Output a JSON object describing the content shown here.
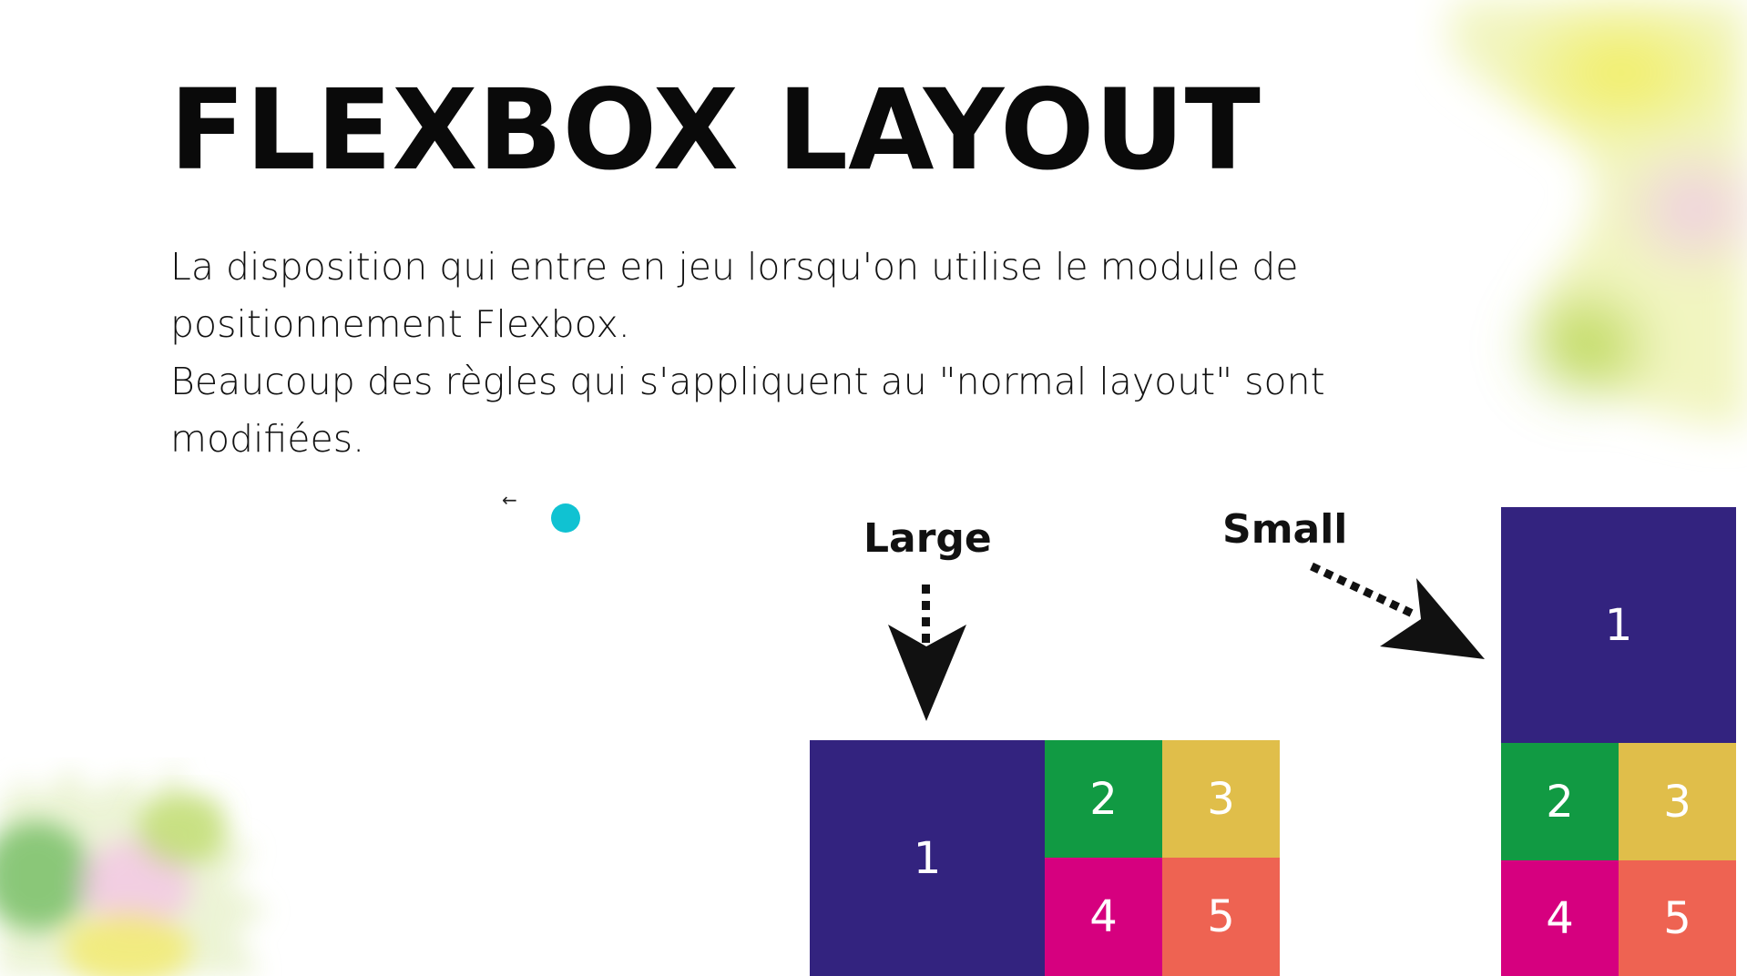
{
  "slide": {
    "title": "FLEXBOX LAYOUT",
    "paragraphs": [
      "La disposition qui entre en jeu lorsqu'on utilise le module de positionnement Flexbox.",
      "Beaucoup des règles qui s'appliquent au \"normal layout\" sont modifiées."
    ],
    "back_glyph": "←"
  },
  "diagram": {
    "large_label": "Large",
    "small_label": "Small",
    "large_items": [
      "1",
      "2",
      "3",
      "4",
      "5"
    ],
    "small_items": [
      "1",
      "2",
      "3",
      "4",
      "5"
    ]
  },
  "colors": {
    "item1": "#33237f",
    "item2": "#119a43",
    "item3": "#e0be4a",
    "item4": "#d6007f",
    "item5": "#ee6352",
    "pointer_dot": "#10c2d2"
  }
}
